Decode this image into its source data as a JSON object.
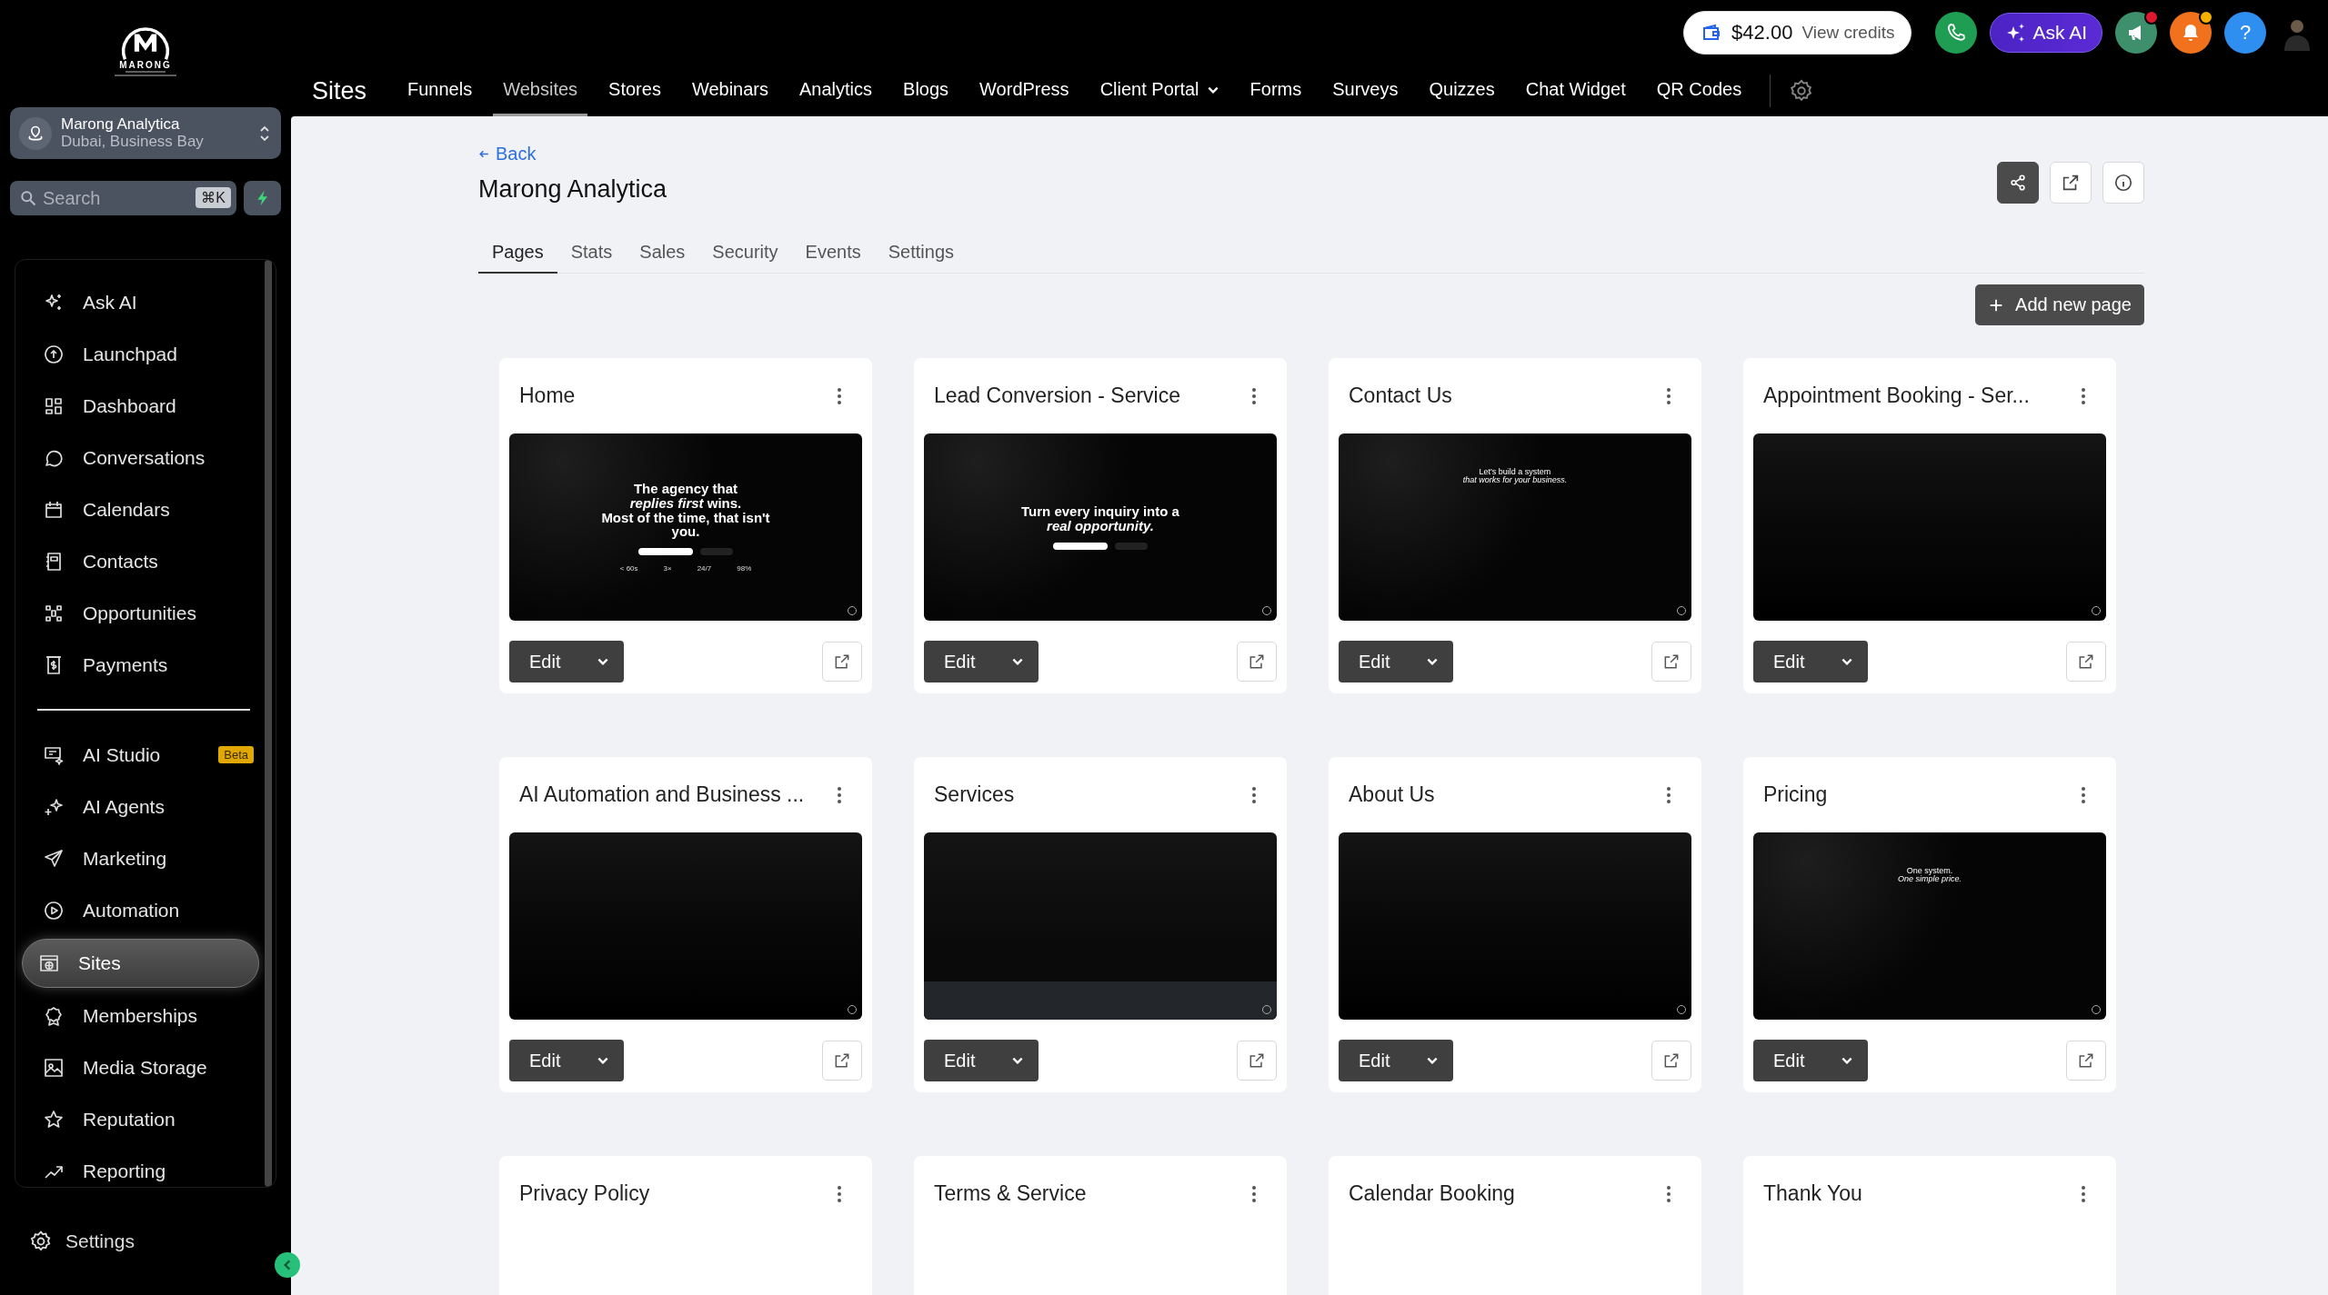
{
  "logo": {
    "name": "MARONG"
  },
  "account": {
    "name": "Marong Analytica",
    "location": "Dubai, Business Bay"
  },
  "search": {
    "placeholder": "Search",
    "shortcut": "⌘K"
  },
  "sidebar": {
    "sections": [
      {
        "items": [
          {
            "label": "Ask AI",
            "selected": false
          },
          {
            "label": "Launchpad",
            "selected": false
          },
          {
            "label": "Dashboard",
            "selected": false
          },
          {
            "label": "Conversations",
            "selected": false
          },
          {
            "label": "Calendars",
            "selected": false
          },
          {
            "label": "Contacts",
            "selected": false
          },
          {
            "label": "Opportunities",
            "selected": false
          },
          {
            "label": "Payments",
            "selected": false
          }
        ]
      },
      {
        "items": [
          {
            "label": "AI Studio",
            "selected": false,
            "badge": "Beta"
          },
          {
            "label": "AI Agents",
            "selected": false
          },
          {
            "label": "Marketing",
            "selected": false
          },
          {
            "label": "Automation",
            "selected": false
          },
          {
            "label": "Sites",
            "selected": true
          },
          {
            "label": "Memberships",
            "selected": false
          },
          {
            "label": "Media Storage",
            "selected": false
          },
          {
            "label": "Reputation",
            "selected": false
          },
          {
            "label": "Reporting",
            "selected": false
          }
        ]
      }
    ],
    "footer": "Settings"
  },
  "topbar": {
    "title": "Sites",
    "nav": [
      {
        "label": "Funnels",
        "selected": false
      },
      {
        "label": "Websites",
        "selected": true
      },
      {
        "label": "Stores",
        "selected": false
      },
      {
        "label": "Webinars",
        "selected": false
      },
      {
        "label": "Analytics",
        "selected": false
      },
      {
        "label": "Blogs",
        "selected": false
      },
      {
        "label": "WordPress",
        "selected": false
      },
      {
        "label": "Client Portal",
        "selected": false,
        "kind": "dropdown"
      },
      {
        "label": "Forms",
        "selected": false
      },
      {
        "label": "Surveys",
        "selected": false
      },
      {
        "label": "Quizzes",
        "selected": false
      },
      {
        "label": "Chat Widget",
        "selected": false
      },
      {
        "label": "QR Codes",
        "selected": false
      }
    ],
    "credits": {
      "amount": "$42.00",
      "link": "View credits"
    },
    "actions": [
      {
        "kind": "phone"
      },
      {
        "kind": "ask_ai",
        "label": "Ask AI"
      },
      {
        "kind": "announcements",
        "dot": true
      },
      {
        "kind": "notifications",
        "dot": true
      },
      {
        "kind": "help",
        "label": "?"
      },
      {
        "kind": "avatar"
      }
    ]
  },
  "page": {
    "back": "Back",
    "title": "Marong Analytica",
    "tabs": [
      {
        "label": "Pages",
        "selected": true
      },
      {
        "label": "Stats",
        "selected": false
      },
      {
        "label": "Sales",
        "selected": false
      },
      {
        "label": "Security",
        "selected": false
      },
      {
        "label": "Events",
        "selected": false
      },
      {
        "label": "Settings",
        "selected": false
      }
    ],
    "add_button": "Add new page"
  },
  "pages": [
    {
      "title": "Home",
      "edit": "Edit",
      "thumbnail": {
        "kind": "hero",
        "lines": [
          "The agency that",
          "*replies first* wins.",
          "Most of the time, that isn't",
          "you."
        ],
        "stats": [
          "< 60s",
          "3×",
          "24/7",
          "98%"
        ]
      }
    },
    {
      "title": "Lead Conversion - Service",
      "edit": "Edit",
      "thumbnail": {
        "kind": "hero",
        "lines": [
          "Turn every inquiry into a",
          "*real opportunity.*"
        ]
      }
    },
    {
      "title": "Contact Us",
      "edit": "Edit",
      "thumbnail": {
        "kind": "small",
        "lines": [
          "Let's build a system",
          "*that works for your business.*"
        ]
      }
    },
    {
      "title": "Appointment Booking - Ser...",
      "edit": "Edit",
      "thumbnail": {
        "kind": "dark"
      }
    },
    {
      "title": "AI Automation and Business ...",
      "edit": "Edit",
      "thumbnail": {
        "kind": "dark"
      }
    },
    {
      "title": "Services",
      "edit": "Edit",
      "thumbnail": {
        "kind": "footer"
      }
    },
    {
      "title": "About Us",
      "edit": "Edit",
      "thumbnail": {
        "kind": "dark"
      }
    },
    {
      "title": "Pricing",
      "edit": "Edit",
      "thumbnail": {
        "kind": "small",
        "lines": [
          "One system.",
          "*One simple price.*"
        ]
      }
    },
    {
      "title": "Privacy Policy"
    },
    {
      "title": "Terms & Service"
    },
    {
      "title": "Calendar Booking"
    },
    {
      "title": "Thank You"
    }
  ]
}
